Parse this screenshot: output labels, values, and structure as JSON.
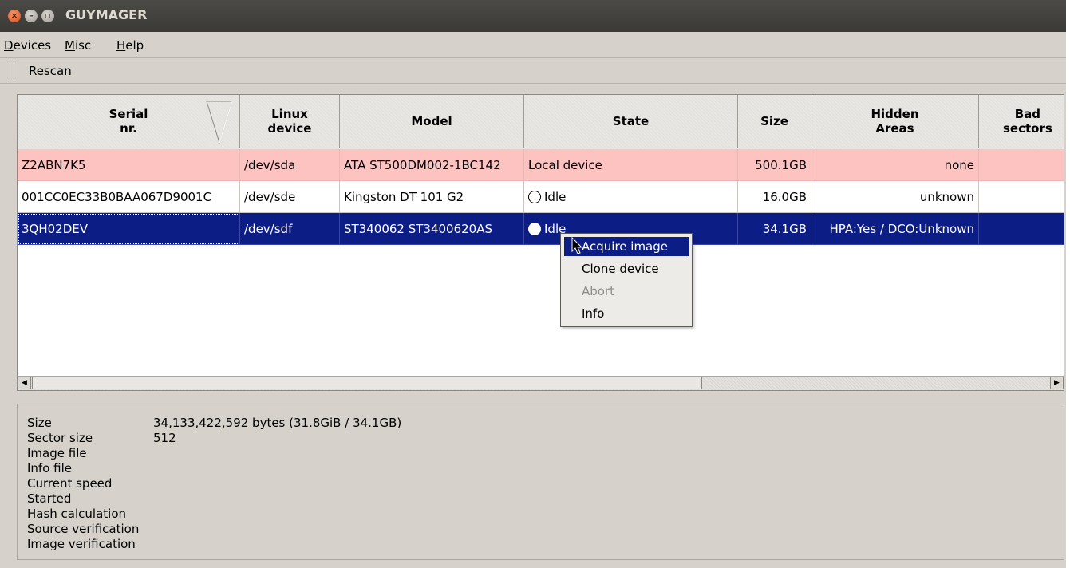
{
  "window": {
    "title": "GUYMAGER",
    "controls": {
      "close_glyph": "×",
      "min_glyph": "–",
      "max_glyph": "▫"
    }
  },
  "menubar": {
    "items": [
      {
        "label": "Devices",
        "accel": "D",
        "rest": "evices"
      },
      {
        "label": "Misc",
        "accel": "M",
        "rest": "isc"
      },
      {
        "label": "Help",
        "accel": "H",
        "rest": "elp"
      }
    ]
  },
  "toolbar": {
    "rescan_label": "Rescan"
  },
  "table": {
    "columns": [
      {
        "line1": "Serial",
        "line2": "nr."
      },
      {
        "line1": "Linux",
        "line2": "device"
      },
      {
        "line1": "Model",
        "line2": ""
      },
      {
        "line1": "State",
        "line2": ""
      },
      {
        "line1": "Size",
        "line2": ""
      },
      {
        "line1": "Hidden",
        "line2": "Areas"
      },
      {
        "line1": "Bad",
        "line2": "sectors"
      }
    ],
    "rows": [
      {
        "serial": "Z2ABN7K5",
        "device": "/dev/sda",
        "model": "ATA ST500DM002-1BC142",
        "state": "Local device",
        "size": "500.1GB",
        "hidden": "none",
        "bad": ""
      },
      {
        "serial": "001CC0EC33B0BAA067D9001C",
        "device": "/dev/sde",
        "model": "Kingston DT 101 G2",
        "state": "Idle",
        "size": "16.0GB",
        "hidden": "unknown",
        "bad": ""
      },
      {
        "serial": "3QH02DEV",
        "device": "/dev/sdf",
        "model": "ST340062 ST3400620AS",
        "state": "Idle",
        "size": "34.1GB",
        "hidden": "HPA:Yes / DCO:Unknown",
        "bad": ""
      }
    ],
    "selected_row_index": 2
  },
  "context_menu": {
    "items": [
      {
        "label": "Acquire image",
        "highlighted": true,
        "enabled": true
      },
      {
        "label": "Clone device",
        "highlighted": false,
        "enabled": true
      },
      {
        "label": "Abort",
        "highlighted": false,
        "enabled": false
      },
      {
        "label": "Info",
        "highlighted": false,
        "enabled": true
      }
    ]
  },
  "info": {
    "labels": [
      "Size",
      "Sector size",
      "Image file",
      "Info file",
      "Current speed",
      "Started",
      "Hash calculation",
      "Source verification",
      "Image verification"
    ],
    "values": [
      "34,133,422,592 bytes (31.8GiB / 34.1GB)",
      "512",
      "",
      "",
      "",
      "",
      "",
      "",
      ""
    ]
  },
  "colors": {
    "local_row": "#fdc3c0",
    "selected_row": "#0d1d86",
    "titlebar": "#3b3a36",
    "window_bg": "#d6d2cb"
  }
}
